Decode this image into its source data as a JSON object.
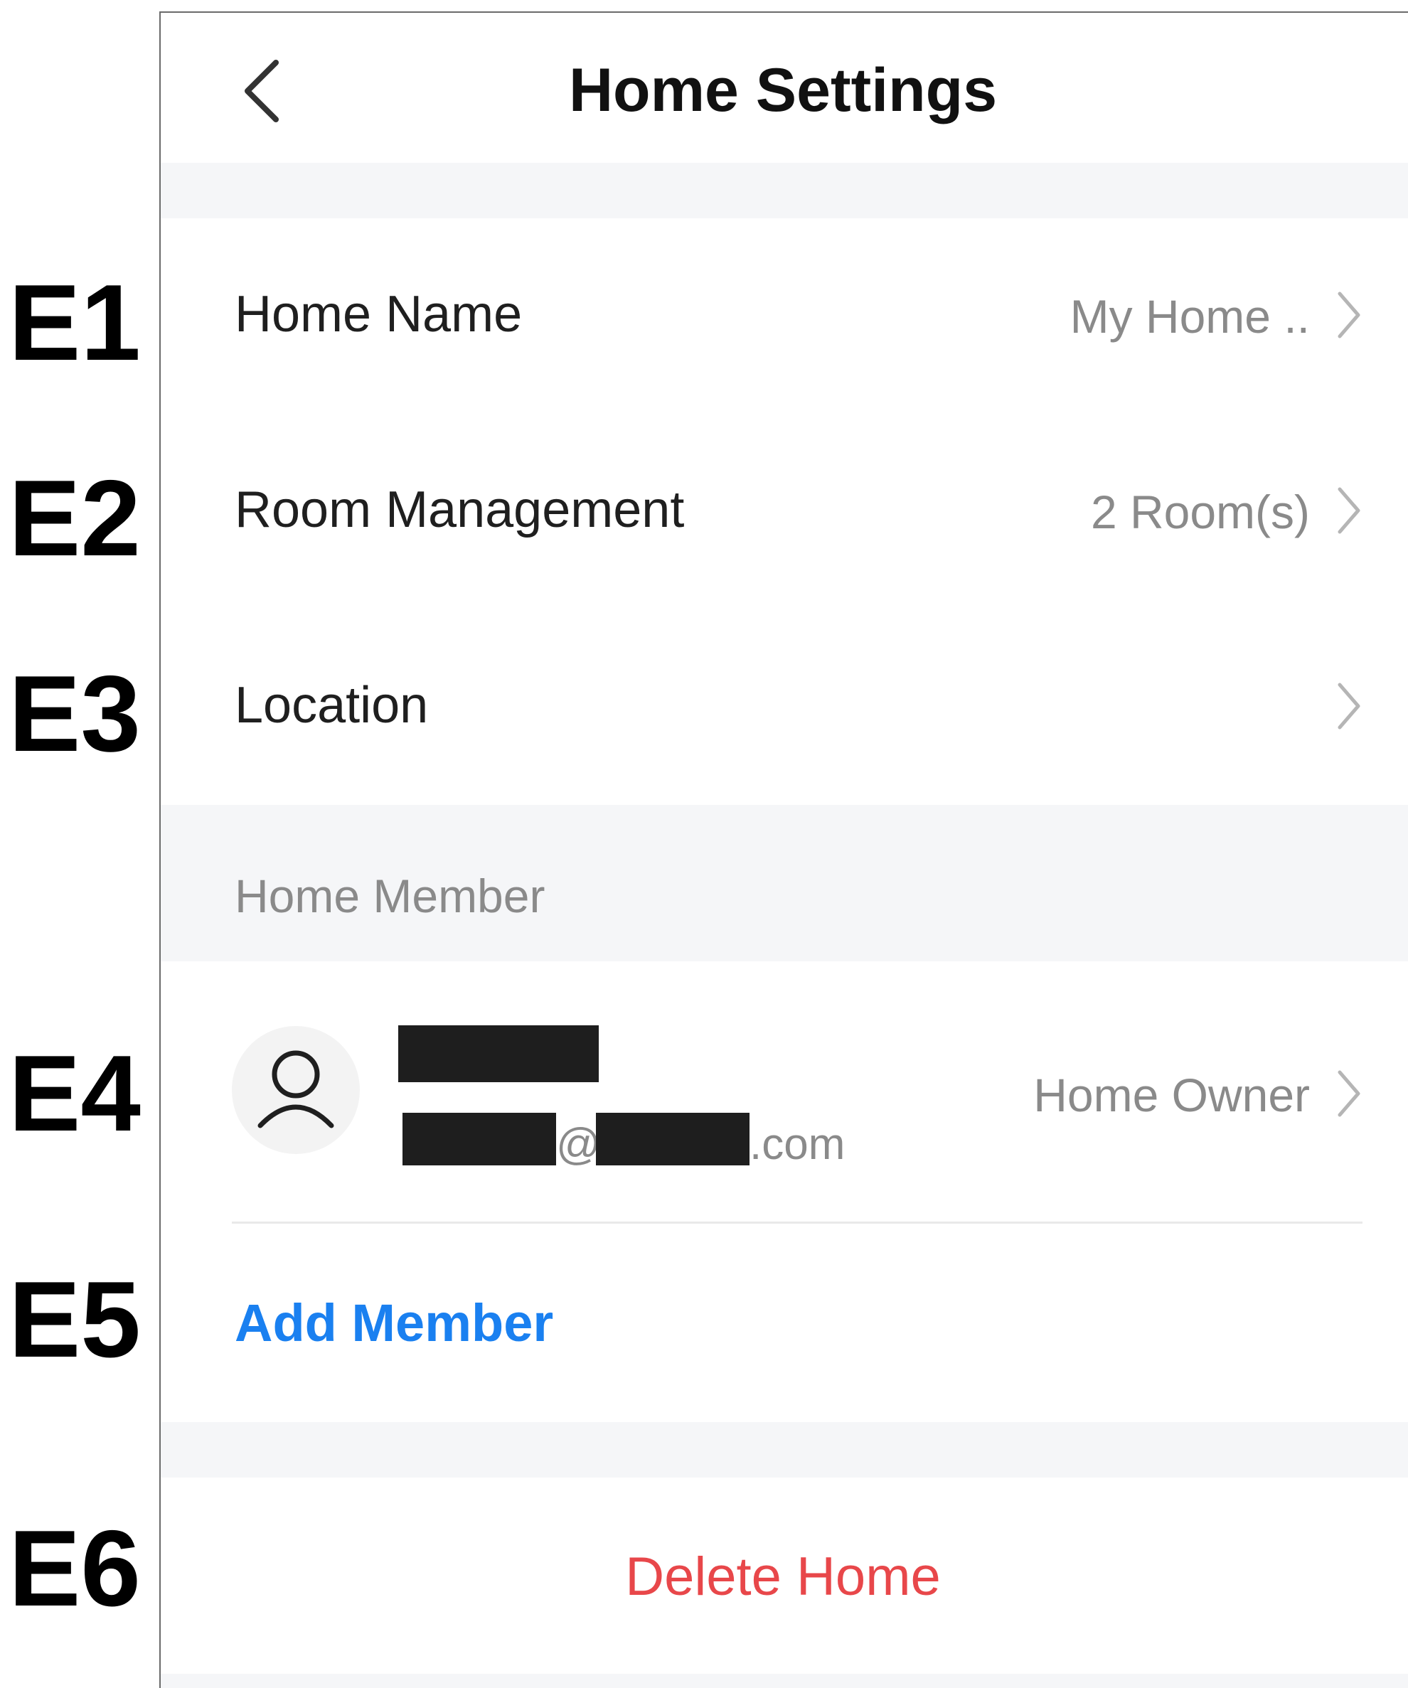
{
  "callouts": [
    "E1",
    "E2",
    "E3",
    "E4",
    "E5",
    "E6"
  ],
  "header": {
    "title": "Home Settings",
    "back_icon": "chevron-left-icon"
  },
  "rows": {
    "home_name": {
      "label": "Home Name",
      "value": "My Home .."
    },
    "room_management": {
      "label": "Room Management",
      "value": "2 Room(s)"
    },
    "location": {
      "label": "Location",
      "value": ""
    }
  },
  "members_section": {
    "title": "Home Member",
    "member": {
      "avatar_icon": "user-icon",
      "email_at": "@",
      "email_domain_suffix": ".com",
      "role": "Home Owner"
    },
    "add_member_label": "Add Member"
  },
  "delete_home_label": "Delete Home",
  "colors": {
    "accent_blue": "#1a80f0",
    "danger_red": "#e8474a",
    "section_background": "#f5f6f8",
    "secondary_text": "#8a8a8a",
    "chevron": "#b5b5b5"
  }
}
